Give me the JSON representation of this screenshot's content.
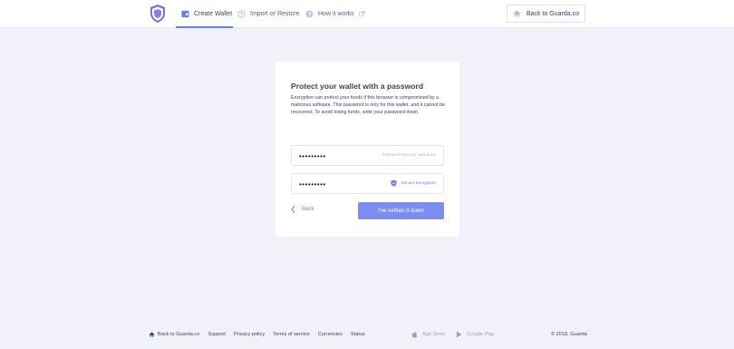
{
  "header": {
    "tabs": [
      {
        "label": "Create Wallet",
        "active": true
      },
      {
        "label": "Import or Restore",
        "active": false
      },
      {
        "label": "How it works",
        "active": false
      }
    ],
    "back_button": "Back to Guarda.co"
  },
  "card": {
    "title": "Protect your wallet with a password",
    "description": "Encryption can protect your funds if this browser is compromised by a malicious software. This password is only for this wallet, and it cannot be recovered. To avoid losing funds, write your password down.",
    "password_value": "•••••••••",
    "password_hint": "Password security: well done",
    "confirm_value": "•••••••••",
    "secure_label": "Secure encryption",
    "back_label": "Back",
    "submit_label": "I've written it down"
  },
  "footer": {
    "links": [
      "Back to Guarda.co",
      "Support",
      "Privacy policy",
      "Terms of service",
      "Currencies",
      "Status"
    ],
    "app_store": "App Store",
    "google_play": "Google Play",
    "copyright": "© 2018, Guarda"
  },
  "colors": {
    "accent": "#6b7cf0",
    "button": "#7d8cf0",
    "background": "#f1f2f9"
  }
}
